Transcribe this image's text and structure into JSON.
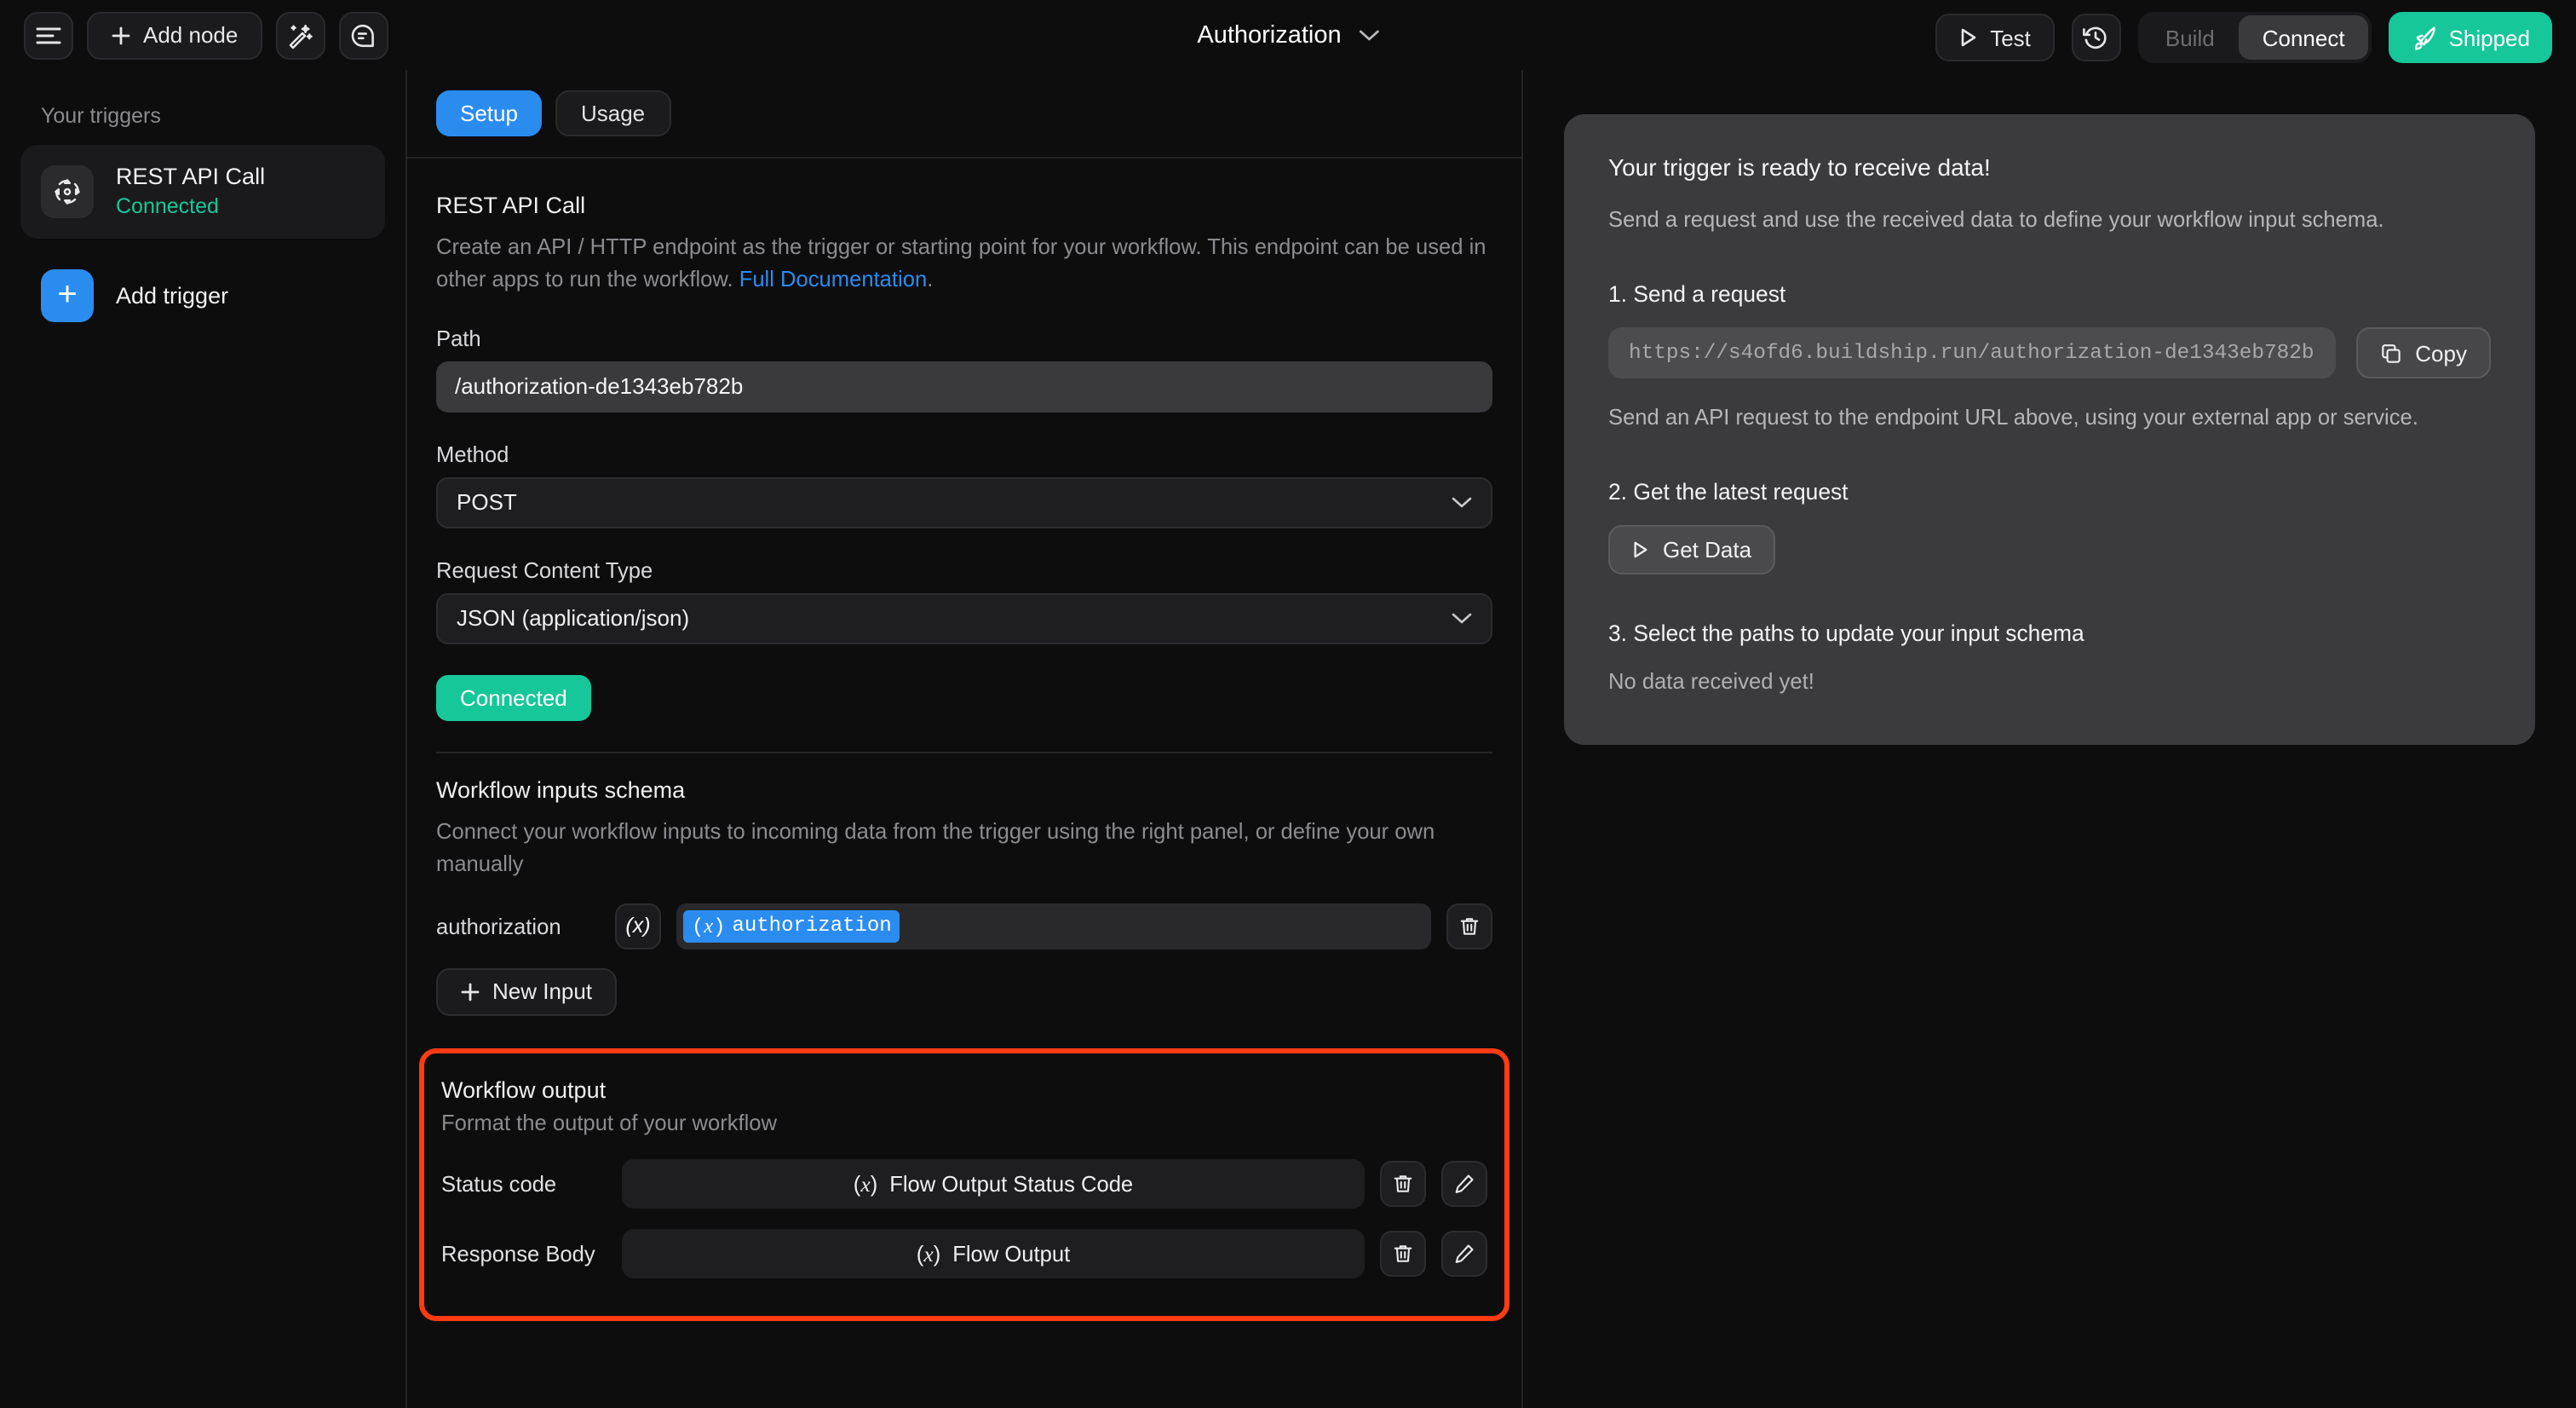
{
  "header": {
    "menu_icon": "hamburger-icon",
    "add_node_label": "Add node",
    "magic_icon": "magic-wand-icon",
    "chat_icon": "chat-bubble-icon",
    "title": "Authorization",
    "chevron_icon": "chevron-down-icon",
    "test_label": "Test",
    "history_icon": "history-clock-icon",
    "segment": {
      "build_label": "Build",
      "connect_label": "Connect",
      "active": "Connect"
    },
    "shipped_label": "Shipped",
    "shipped_icon": "rocket-icon",
    "accent_green": "#16c79a",
    "accent_blue": "#2b8cf0"
  },
  "sidebar": {
    "section_label": "Your triggers",
    "trigger": {
      "icon": "rest-api-trigger-icon",
      "name": "REST API Call",
      "status": "Connected",
      "status_color": "#16c79a"
    },
    "add_trigger_label": "Add trigger",
    "add_trigger_icon": "plus-icon"
  },
  "tabs": [
    {
      "label": "Setup",
      "active": true
    },
    {
      "label": "Usage",
      "active": false
    }
  ],
  "setup": {
    "title": "REST API Call",
    "description_part1": "Create an API / HTTP endpoint as the trigger or starting point for your workflow. This endpoint can be used in other apps to run the workflow. ",
    "doc_link_label": "Full Documentation",
    "description_part2": ".",
    "path_label": "Path",
    "path_value": "/authorization-de1343eb782b",
    "method_label": "Method",
    "method_value": "POST",
    "content_type_label": "Request Content Type",
    "content_type_value": "JSON (application/json)",
    "connected_label": "Connected"
  },
  "inputs_schema": {
    "title": "Workflow inputs schema",
    "description": "Connect your workflow inputs to incoming data from the trigger using the right panel, or define your own manually",
    "rows": [
      {
        "key": "authorization",
        "fx_icon": "fx-icon",
        "token_prefix": "(x)",
        "token_label": "authorization",
        "delete_icon": "trash-icon"
      }
    ],
    "new_input_label": "New Input",
    "new_input_icon": "plus-icon"
  },
  "workflow_output": {
    "title": "Workflow output",
    "subtitle": "Format the output of your workflow",
    "highlight_color": "#ff3b14",
    "rows": [
      {
        "key": "Status code",
        "value_prefix": "(x)",
        "value": "Flow Output Status Code",
        "delete_icon": "trash-icon",
        "edit_icon": "pencil-icon"
      },
      {
        "key": "Response Body",
        "value_prefix": "(x)",
        "value": "Flow Output",
        "delete_icon": "trash-icon",
        "edit_icon": "pencil-icon"
      }
    ]
  },
  "right_panel": {
    "title": "Your trigger is ready to receive data!",
    "subtitle": "Send a request and use the received data to define your workflow input schema.",
    "step1_label": "1. Send a request",
    "endpoint_url": "https://s4ofd6.buildship.run/authorization-de1343eb782b",
    "copy_label": "Copy",
    "copy_icon": "copy-icon",
    "step1_hint": "Send an API request to the endpoint URL above, using your external app or service.",
    "step2_label": "2. Get the latest request",
    "get_data_label": "Get Data",
    "get_data_icon": "play-icon",
    "step3_label": "3. Select the paths to update your input schema",
    "no_data_label": "No data received yet!"
  }
}
